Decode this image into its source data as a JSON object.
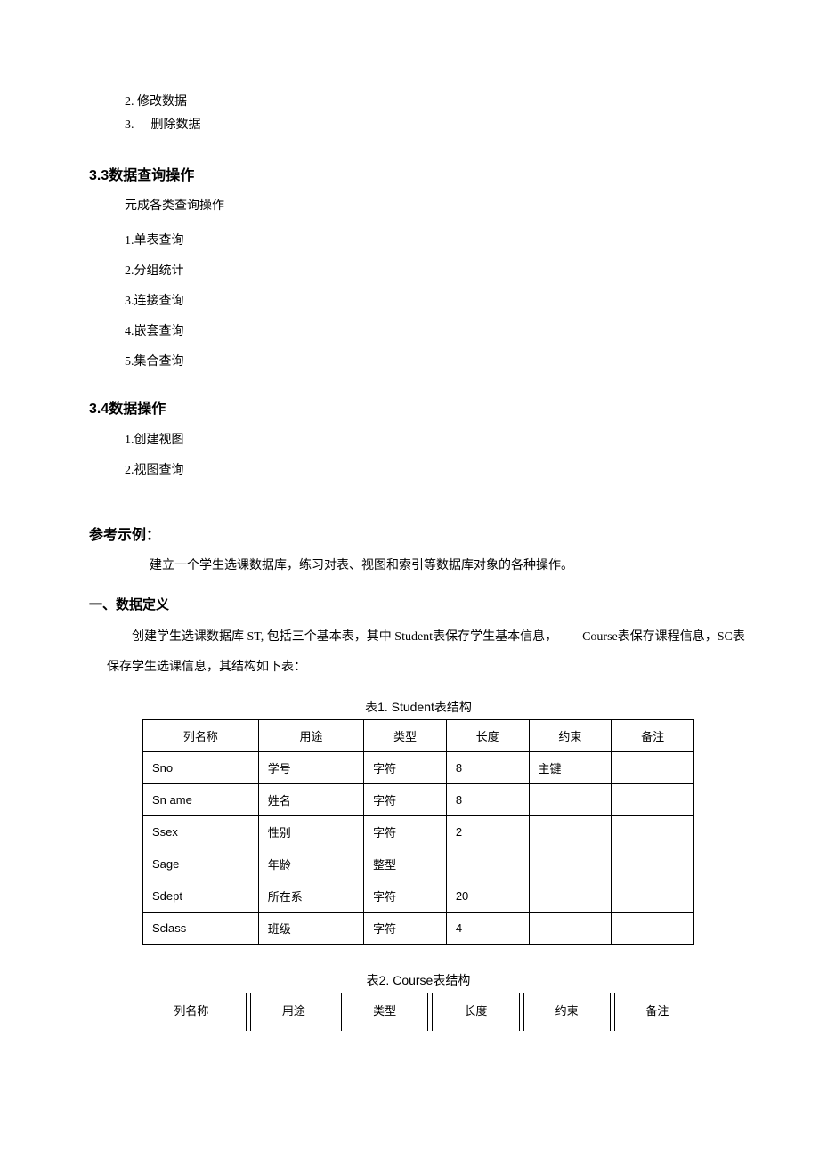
{
  "pre_items": [
    {
      "num": "2.",
      "text": "修改数据"
    },
    {
      "num": "3.",
      "text": "删除数据"
    }
  ],
  "sec33": {
    "heading": "3.3数据查询操作",
    "intro": "元成各类查询操作",
    "items": [
      {
        "num": "1.",
        "text": "单表查询"
      },
      {
        "num": "2.",
        "text": "分组统计"
      },
      {
        "num": "3.",
        "text": "连接查询"
      },
      {
        "num": "4.",
        "text": "嵌套查询"
      },
      {
        "num": "5.",
        "text": "集合查询"
      }
    ]
  },
  "sec34": {
    "heading": "3.4数据操作",
    "items": [
      {
        "num": "1.",
        "text": "创建视图"
      },
      {
        "num": "2.",
        "text": "视图查询"
      }
    ]
  },
  "example": {
    "heading": "参考示例：",
    "intro": "建立一个学生选课数据库，练习对表、视图和索引等数据库对象的各种操作。"
  },
  "datadef": {
    "heading": "一、数据定义",
    "body": "创建学生选课数据库 ST, 包括三个基本表，其中 Student表保存学生基本信息，  Course表保存课程信息，SC表保存学生选课信息，其结构如下表："
  },
  "table1": {
    "caption": "表1. Student表结构",
    "headers": [
      "列名称",
      "用途",
      "类型",
      "长度",
      "约束",
      "备注"
    ],
    "rows": [
      [
        "Sno",
        "学号",
        "字符",
        "8",
        "主键",
        ""
      ],
      [
        "Sn ame",
        "姓名",
        "字符",
        "8",
        "",
        ""
      ],
      [
        "Ssex",
        "性别",
        "字符",
        "2",
        "",
        ""
      ],
      [
        "Sage",
        "年龄",
        "整型",
        "",
        "",
        ""
      ],
      [
        "Sdept",
        "所在系",
        "字符",
        "20",
        "",
        ""
      ],
      [
        "Sclass",
        "班级",
        "字符",
        "4",
        "",
        ""
      ]
    ]
  },
  "table2": {
    "caption": "表2. Course表结构",
    "headers": [
      "列名称",
      "用途",
      "类型",
      "长度",
      "约束",
      "备注"
    ]
  }
}
